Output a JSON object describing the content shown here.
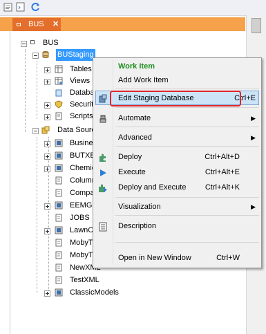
{
  "tab": {
    "label": "BUS",
    "close": "✕"
  },
  "tree": {
    "root": "BUS",
    "staging": "BUStaging",
    "children": [
      "Tables",
      "Views",
      "Databa",
      "Securit",
      "Scripts"
    ],
    "data_sources": "Data Sourc",
    "sources": [
      "Busine",
      "BUTXE",
      "Chemic",
      "Column",
      "Compa",
      "EEMG",
      "JOBS",
      "LawnC",
      "MobyT",
      "MobyT",
      "NewXML",
      "TestXML",
      "ClassicModels"
    ]
  },
  "menu": {
    "work_item_header": "Work Item",
    "add_work_item": "Add Work Item",
    "edit_staging": "Edit Staging Database",
    "edit_staging_key": "Ctrl+E",
    "automate": "Automate",
    "advanced": "Advanced",
    "deploy": "Deploy",
    "deploy_key": "Ctrl+Alt+D",
    "execute": "Execute",
    "execute_key": "Ctrl+Alt+E",
    "deploy_execute": "Deploy and Execute",
    "deploy_execute_key": "Ctrl+Alt+K",
    "visualization": "Visualization",
    "description": "Description",
    "open_new_window": "Open in New Window",
    "open_new_window_key": "Ctrl+W",
    "submenu_arrow": "▶"
  },
  "colors": {
    "work_item_green": "#1e8e1e",
    "tab_orange": "#e46f2c",
    "strip_orange": "#f5a24b",
    "selection_blue": "#3399ff",
    "highlight_red": "#e0262b"
  }
}
